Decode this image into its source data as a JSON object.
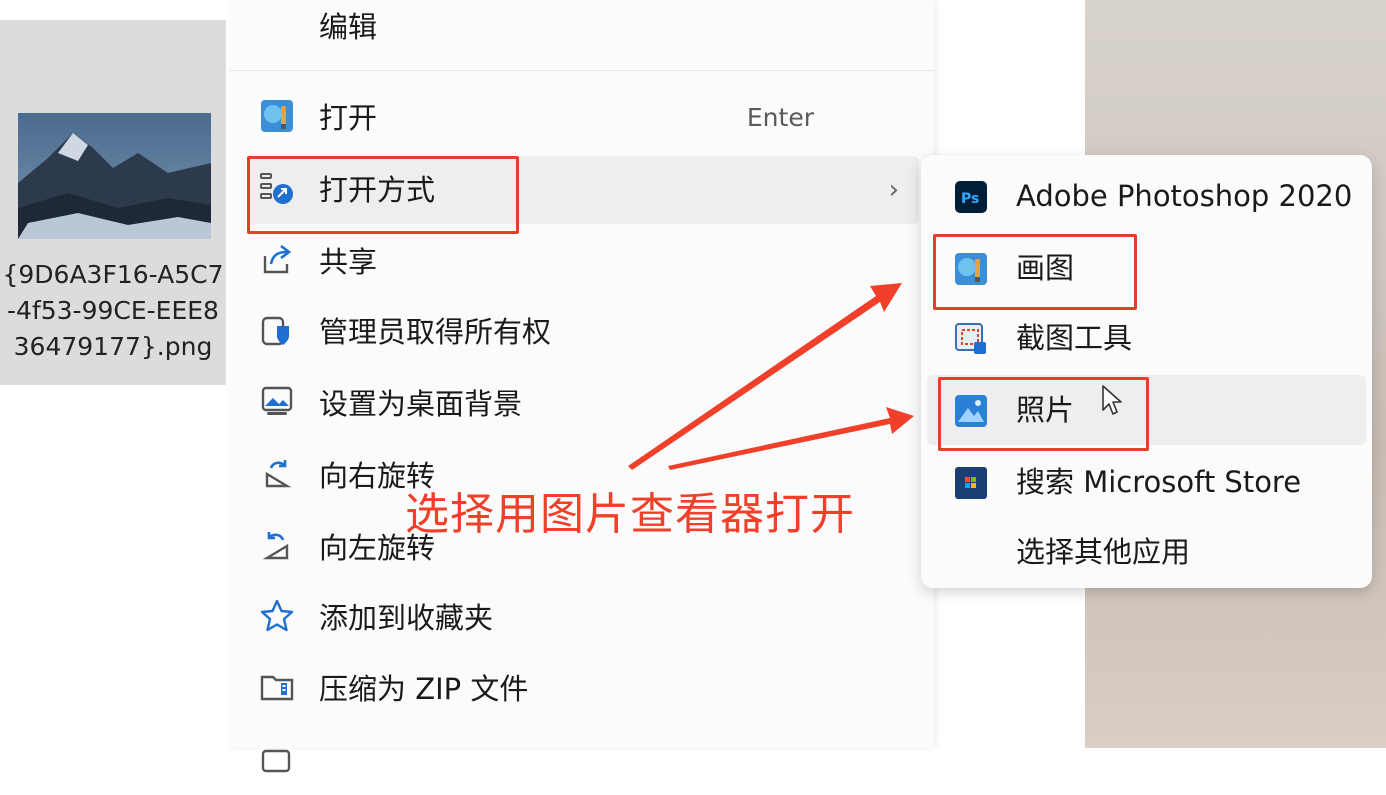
{
  "file": {
    "name": "{9D6A3F16-A5C7-4f53-99CE-EEE836479177}.png"
  },
  "menu": {
    "items": [
      {
        "label": "编辑",
        "icon": "none"
      },
      {
        "label": "打开",
        "shortcut": "Enter",
        "icon": "paint-icon"
      },
      {
        "label": "打开方式",
        "icon": "open-with-icon",
        "has_submenu": true,
        "chevron": "›"
      },
      {
        "label": "共享",
        "icon": "share-icon"
      },
      {
        "label": "管理员取得所有权",
        "icon": "admin-shield-icon"
      },
      {
        "label": "设置为桌面背景",
        "icon": "wallpaper-icon"
      },
      {
        "label": "向右旋转",
        "icon": "rotate-right-icon"
      },
      {
        "label": "向左旋转",
        "icon": "rotate-left-icon"
      },
      {
        "label": "添加到收藏夹",
        "icon": "star-icon"
      },
      {
        "label": "压缩为 ZIP 文件",
        "icon": "zip-icon"
      }
    ]
  },
  "submenu": {
    "items": [
      {
        "label": "Adobe Photoshop 2020",
        "icon": "photoshop-icon"
      },
      {
        "label": "画图",
        "icon": "paint-icon"
      },
      {
        "label": "截图工具",
        "icon": "snipping-tool-icon"
      },
      {
        "label": "照片",
        "icon": "photos-icon"
      },
      {
        "label": "搜索 Microsoft Store",
        "icon": "store-icon"
      },
      {
        "label": "选择其他应用",
        "icon": "none"
      }
    ]
  },
  "annotation": {
    "text": "选择用图片查看器打开"
  },
  "colors": {
    "highlight": "#e0412a",
    "menu_bg": "#fbfbfb",
    "hover_bg": "#eeeeee"
  }
}
